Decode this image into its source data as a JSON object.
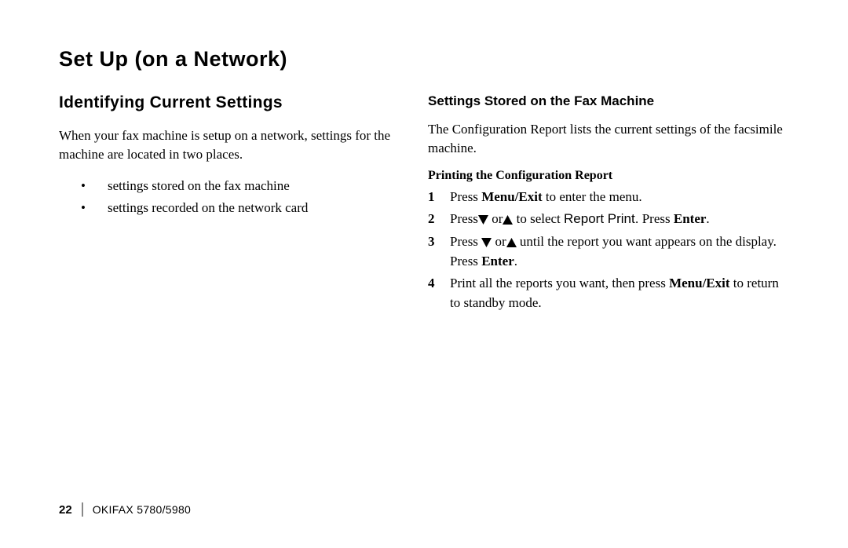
{
  "heading": "Set Up (on a Network)",
  "left": {
    "subheading": "Identifying Current Settings",
    "intro": "When your fax machine is setup on a network, settings for the machine are located in two places.",
    "bullets": [
      "settings stored on the fax machine",
      "settings recorded on the network card"
    ]
  },
  "right": {
    "sectionTitle": "Settings Stored on the Fax Machine",
    "description": "The Configuration Report lists the current settings of the facsimile machine.",
    "subSectionTitle": "Printing the Configuration Report",
    "steps": {
      "s1": {
        "num": "1",
        "a": "Press ",
        "b": "Menu/Exit",
        "c": " to enter the menu."
      },
      "s2": {
        "num": "2",
        "a": "Press",
        "b": " or",
        "c": " to select ",
        "d": "Report Print.",
        "e": "  Press ",
        "f": "Enter",
        "g": "."
      },
      "s3": {
        "num": "3",
        "a": "Press ",
        "b": " or",
        "c": " until the report you want appears on the display.  Press ",
        "d": "Enter",
        "e": "."
      },
      "s4": {
        "num": "4",
        "a": "Print all the reports you want, then press ",
        "b": "Menu/Exit",
        "c": " to return to standby mode."
      }
    }
  },
  "footer": {
    "pageNumber": "22",
    "model": "OKIFAX 5780/5980"
  }
}
